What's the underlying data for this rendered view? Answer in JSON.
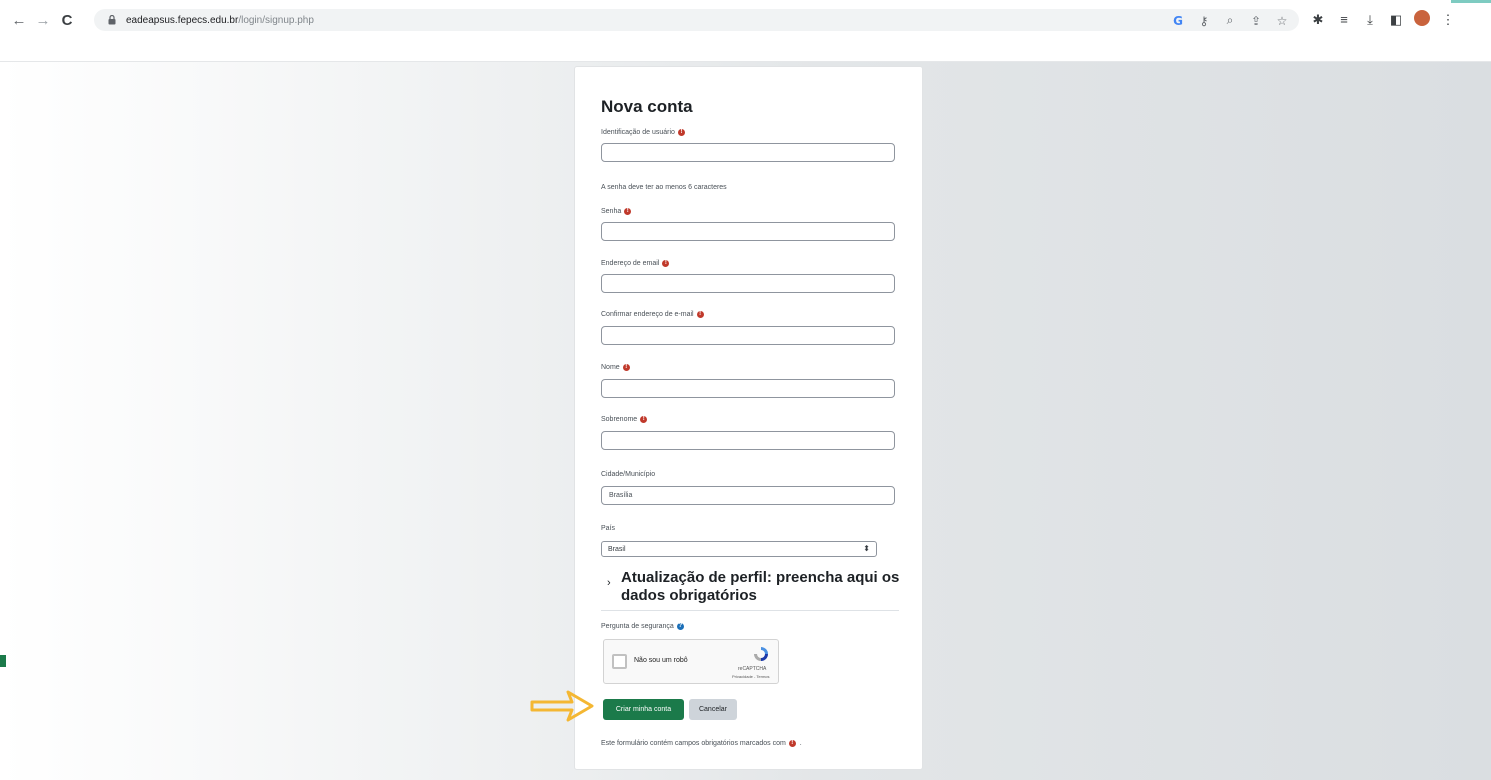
{
  "browser": {
    "url_host": "eadeapsus.fepecs.edu.br",
    "url_path": "/login/signup.php"
  },
  "form": {
    "title": "Nova conta",
    "username_label": "Identificação de usuário",
    "password_note": "A senha deve ter ao menos 6 caracteres",
    "password_label": "Senha",
    "email_label": "Endereço de email",
    "email_confirm_label": "Confirmar endereço de e-mail",
    "firstname_label": "Nome",
    "lastname_label": "Sobrenome",
    "city_label": "Cidade/Município",
    "city_value": "Brasília",
    "country_label": "País",
    "country_value": "Brasil",
    "profile_section_line1": "Atualização de perfil: preencha aqui os",
    "profile_section_line2": "dados obrigatórios",
    "security_label": "Pergunta de segurança",
    "recaptcha_text": "Não sou um robô",
    "recaptcha_brand": "reCAPTCHA",
    "recaptcha_terms": "Privacidade - Termos",
    "submit_label": "Criar minha conta",
    "cancel_label": "Cancelar",
    "required_note": "Este formulário contém campos obrigatórios marcados com"
  },
  "icons": {
    "back": "arrow-left-icon",
    "forward": "arrow-right-icon",
    "reload": "reload-icon",
    "lock": "lock-icon",
    "required": "exclamation-circle-icon",
    "help": "question-circle-icon",
    "expand": "chevron-right-icon",
    "highlight": "pointer-arrow-icon"
  },
  "colors": {
    "primary": "#1b7a4a",
    "required": "#c0392b",
    "help": "#1b6fb8",
    "arrow": "#f4b733"
  }
}
